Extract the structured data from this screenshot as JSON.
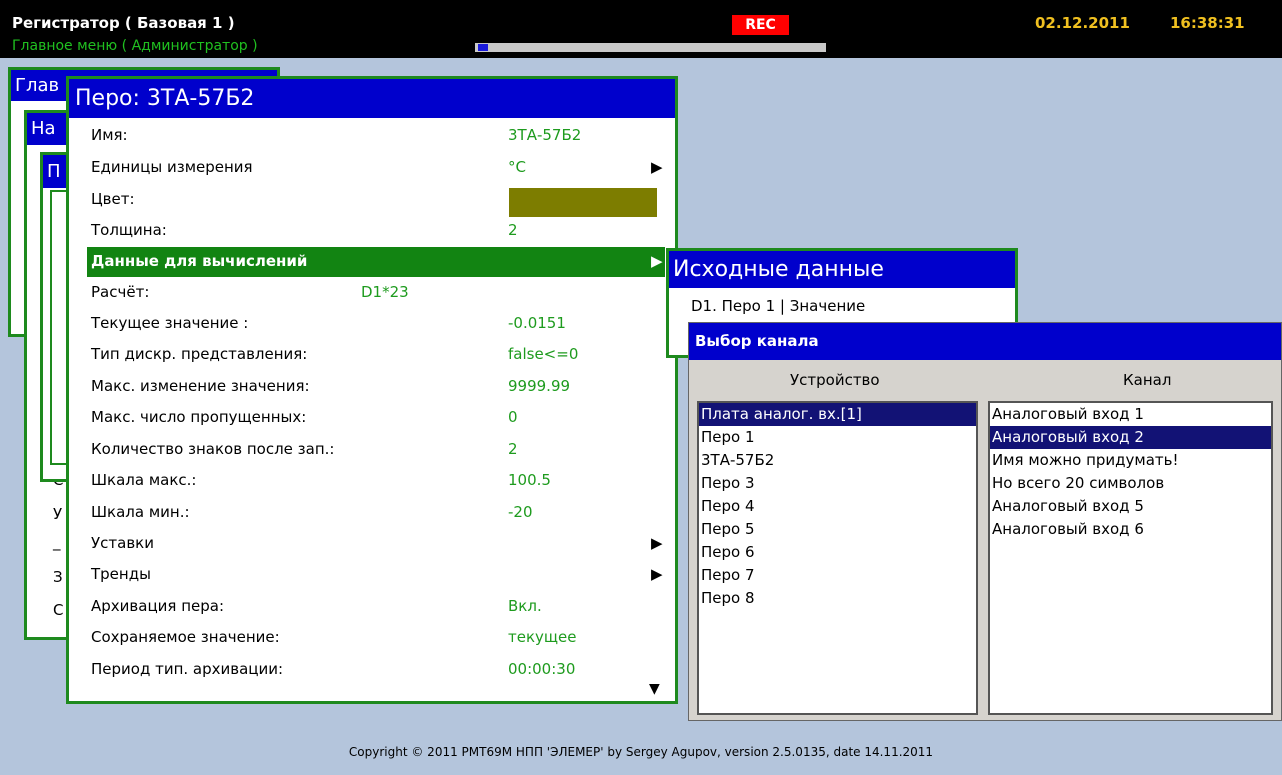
{
  "header": {
    "title": "Регистратор ( Базовая 1 )",
    "subtitle": "Главное меню ( Администратор )",
    "rec_label": "REC",
    "progress_value": 0.03,
    "date": "02.12.2011",
    "time": "16:38:31"
  },
  "back_windows": {
    "w1_title": "Глав",
    "w2_title": "На",
    "w3_title": "П",
    "fragments": [
      "С",
      "У",
      "_",
      "З",
      "С"
    ]
  },
  "pen_window": {
    "title": "Перо: 3ТА-57Б2",
    "rows": [
      {
        "label": "Имя:",
        "value": "3ТА-57Б2"
      },
      {
        "label": "Единицы измерения",
        "value": "°C",
        "arrow": "▶"
      },
      {
        "label": "Цвет:",
        "swatch_color": "#7d7d00"
      },
      {
        "label": "Толщина:",
        "value": "2"
      },
      {
        "label": "Данные для вычислений",
        "arrow": "▶",
        "selected": true
      },
      {
        "label": "Расчёт:",
        "value": "D1*23"
      },
      {
        "label": "Текущее значение :",
        "value": "-0.0151"
      },
      {
        "label": "Тип дискр. представления:",
        "value": "false<=0"
      },
      {
        "label": "Макс. изменение значения:",
        "value": "9999.99"
      },
      {
        "label": "Макс. число пропущенных:",
        "value": "0"
      },
      {
        "label": "Количество знаков после зап.:",
        "value": "2"
      },
      {
        "label": "Шкала макс.:",
        "value": "100.5"
      },
      {
        "label": "Шкала мин.:",
        "value": "-20"
      },
      {
        "label": "Уставки",
        "arrow": "▶"
      },
      {
        "label": "Тренды",
        "arrow": "▶"
      },
      {
        "label": "Архивация пера:",
        "value": "Вкл."
      },
      {
        "label": "Сохраняемое значение:",
        "value": "текущее"
      },
      {
        "label": "Период тип. архивации:",
        "value": "00:00:30"
      }
    ],
    "scroll_down_icon": "▼"
  },
  "source_window": {
    "title": "Исходные данные",
    "item": "D1. Перо 1 | Значение"
  },
  "channel_window": {
    "title": "Выбор канала",
    "device_header": "Устройство",
    "channel_header": "Канал",
    "devices": [
      "Плата аналог. вх.[1]",
      "Перо 1",
      "3ТА-57Б2",
      "Перо 3",
      "Перо 4",
      "Перо 5",
      "Перо 6",
      "Перо 7",
      "Перо 8"
    ],
    "devices_selected": 0,
    "channels": [
      "Аналоговый вход 1",
      "Аналоговый вход 2",
      "Имя можно придумать!",
      "Но всего 20 символов",
      "Аналоговый вход 5",
      "Аналоговый вход 6"
    ],
    "channels_selected": 1
  },
  "footer": {
    "copyright": "Copyright © 2011 РМТ69М НПП 'ЭЛЕМЕР' by Sergey Agupov, version 2.5.0135, date 14.11.2011"
  },
  "colors": {
    "title_blue": "#0000cc",
    "frame_green": "#1e8a1e",
    "value_green": "#1e9b1e",
    "selection_green": "#128412",
    "list_highlight": "#121275",
    "rec_red": "#ff0000",
    "clock_yellow": "#f0c020"
  }
}
